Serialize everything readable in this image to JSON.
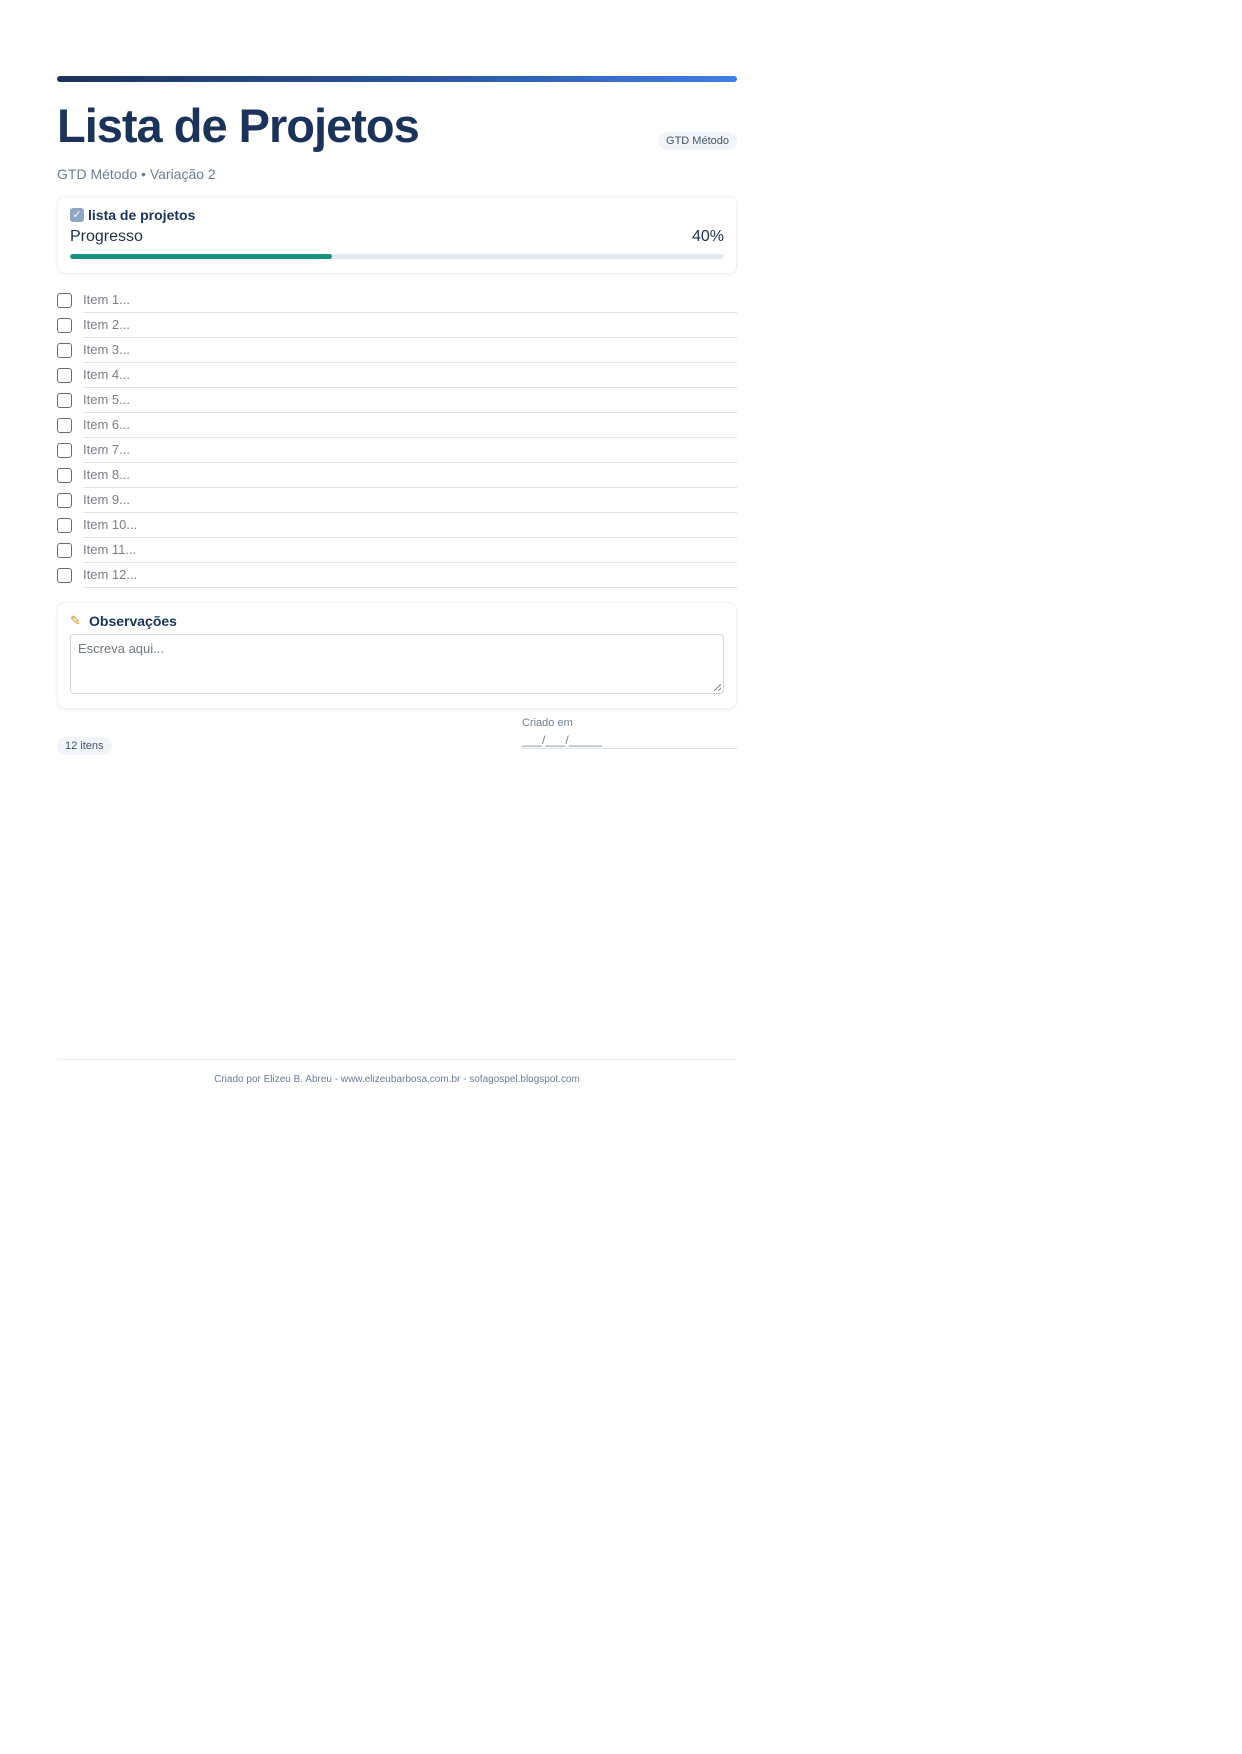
{
  "header": {
    "title": "Lista de Projetos",
    "method_badge": "GTD Método",
    "subtitle": "GTD Método • Variação 2"
  },
  "progress_card": {
    "title": "lista de projetos",
    "progress_label": "Progresso",
    "progress_text": "40%",
    "progress_value": 0.4,
    "accent_color": "#16937f"
  },
  "checklist": {
    "items": [
      {
        "label": "Item 1...",
        "checked": false
      },
      {
        "label": "Item 2...",
        "checked": false
      },
      {
        "label": "Item 3...",
        "checked": false
      },
      {
        "label": "Item 4...",
        "checked": false
      },
      {
        "label": "Item 5...",
        "checked": false
      },
      {
        "label": "Item 6...",
        "checked": false
      },
      {
        "label": "Item 7...",
        "checked": false
      },
      {
        "label": "Item 8...",
        "checked": false
      },
      {
        "label": "Item 9...",
        "checked": false
      },
      {
        "label": "Item 10...",
        "checked": false
      },
      {
        "label": "Item 11...",
        "checked": false
      },
      {
        "label": "Item 12...",
        "checked": false
      }
    ]
  },
  "notes": {
    "title": "Observações",
    "placeholder": "Escreva aqui..."
  },
  "meta": {
    "count_badge": "12 itens",
    "created_label": "Criado em",
    "created_value": "___/___/_____"
  },
  "footer": {
    "credit": "Criado por Elizeu B. Abreu - www.elizeubarbosa.com.br - sofagospel.blogspot.com"
  },
  "colors": {
    "title": "#1b3358",
    "gradient_start": "#1b3358",
    "gradient_end": "#3f7fe8"
  }
}
